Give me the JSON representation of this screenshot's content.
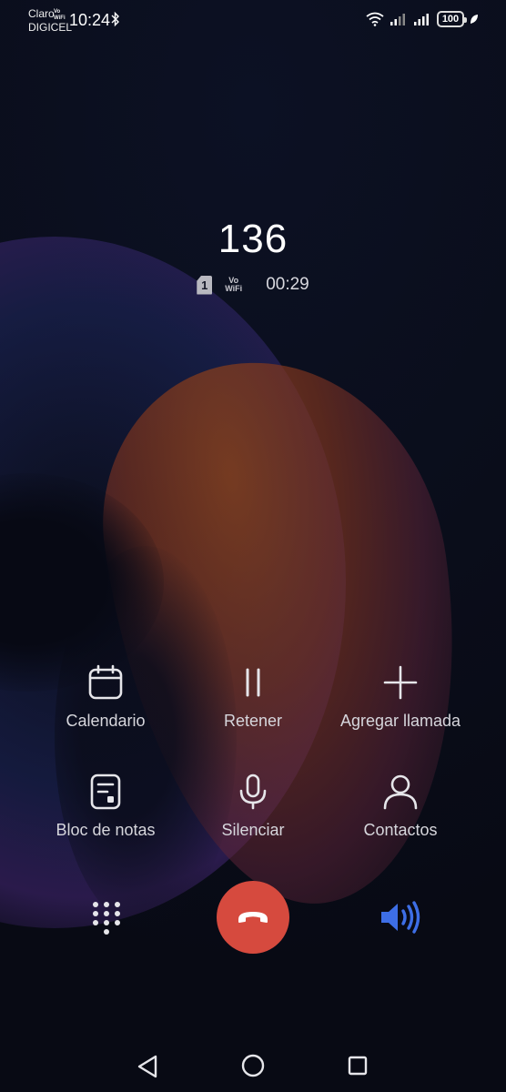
{
  "status_bar": {
    "carrier_top": "Claro",
    "carrier_bottom": "DIGICEL",
    "vowifi_top": "Vo",
    "vowifi_bottom": "WiFi",
    "time": "10:24",
    "battery": "100",
    "icons": [
      "bluetooth-icon",
      "wifi-icon",
      "signal-icon",
      "signal-icon",
      "battery-icon",
      "leaf-icon"
    ]
  },
  "call": {
    "number": "136",
    "sim": "1",
    "vowifi_top": "Vo",
    "vowifi_bottom": "WiFi",
    "duration": "00:29"
  },
  "actions": [
    {
      "label": "Calendario",
      "icon": "calendar-icon"
    },
    {
      "label": "Retener",
      "icon": "pause-icon"
    },
    {
      "label": "Agregar llamada",
      "icon": "plus-icon"
    },
    {
      "label": "Bloc de notas",
      "icon": "notepad-icon"
    },
    {
      "label": "Silenciar",
      "icon": "microphone-icon"
    },
    {
      "label": "Contactos",
      "icon": "person-icon"
    }
  ],
  "controls": {
    "dialpad_icon": "dialpad-icon",
    "hangup_icon": "end-call-icon",
    "speaker_icon": "speaker-icon",
    "speaker_color": "#3d6ee6",
    "hangup_color": "#d64a3e"
  },
  "nav": {
    "icons": [
      "back-icon",
      "home-icon",
      "recents-icon"
    ]
  }
}
